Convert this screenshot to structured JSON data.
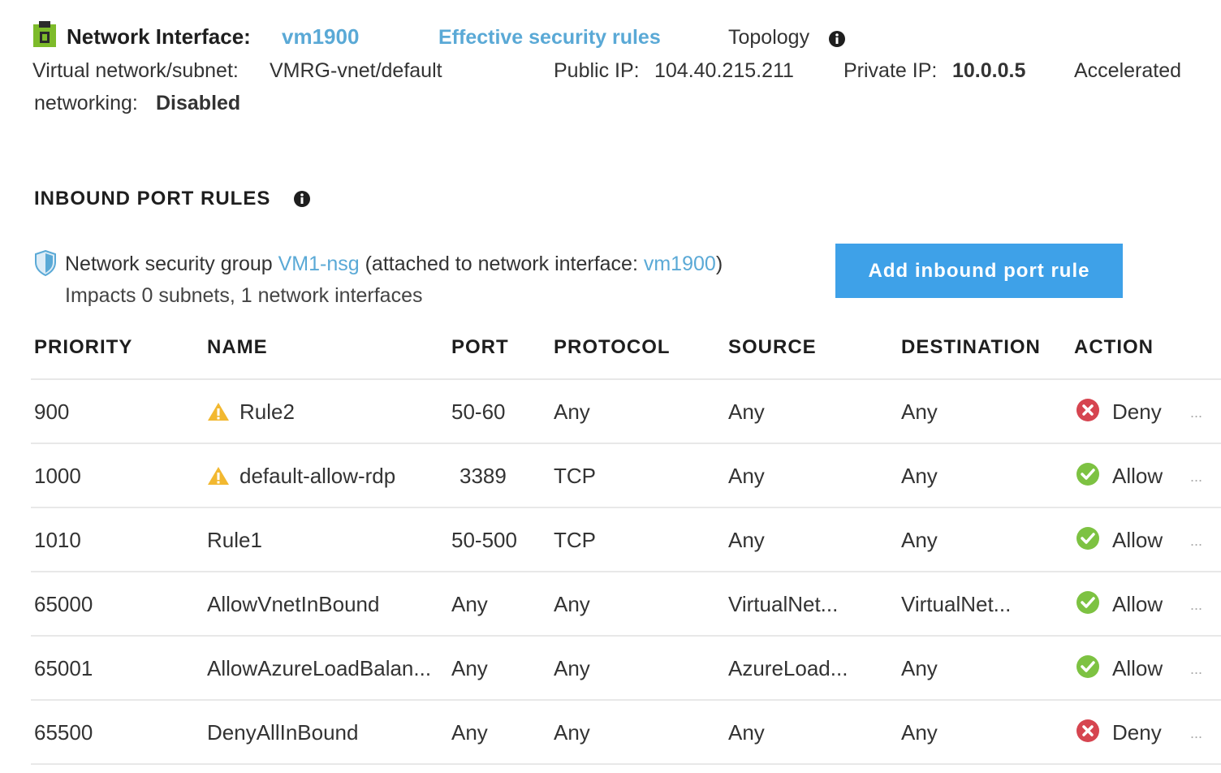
{
  "header": {
    "title": "Network Interface:",
    "vm_name": "vm1900",
    "effective_rules": "Effective security rules",
    "topology": "Topology",
    "vnet_label": "Virtual network/subnet:",
    "vnet_value": "VMRG-vnet/default",
    "public_ip_label": "Public IP:",
    "public_ip_value": "104.40.215.211",
    "private_ip_label": "Private IP:",
    "private_ip_value": "10.0.0.5",
    "accel_label_1": "Accelerated",
    "accel_label_2": "networking:",
    "accel_value": "Disabled"
  },
  "inbound": {
    "title": "INBOUND PORT RULES",
    "nsg_prefix": "Network security group",
    "nsg_name": "VM1-nsg",
    "nsg_attached": "(attached to network interface:",
    "nsg_nic": "vm1900",
    "nsg_close": ")",
    "impacts": "Impacts 0 subnets, 1 network interfaces",
    "add_button": "Add inbound port rule"
  },
  "table": {
    "columns": [
      "PRIORITY",
      "NAME",
      "PORT",
      "PROTOCOL",
      "SOURCE",
      "DESTINATION",
      "ACTION"
    ],
    "rows": [
      {
        "priority": "900",
        "name": "Rule2",
        "warning": true,
        "port": "50-60",
        "protocol": "Any",
        "source": "Any",
        "destination": "Any",
        "action": "Deny",
        "action_type": "deny"
      },
      {
        "priority": "1000",
        "name": "default-allow-rdp",
        "warning": true,
        "port": "3389",
        "protocol": "TCP",
        "source": "Any",
        "destination": "Any",
        "action": "Allow",
        "action_type": "allow"
      },
      {
        "priority": "1010",
        "name": "Rule1",
        "warning": false,
        "port": "50-500",
        "protocol": "TCP",
        "source": "Any",
        "destination": "Any",
        "action": "Allow",
        "action_type": "allow"
      },
      {
        "priority": "65000",
        "name": "AllowVnetInBound",
        "warning": false,
        "port": "Any",
        "protocol": "Any",
        "source": "VirtualNet...",
        "destination": "VirtualNet...",
        "action": "Allow",
        "action_type": "allow"
      },
      {
        "priority": "65001",
        "name": "AllowAzureLoadBalan...",
        "warning": false,
        "port": "Any",
        "protocol": "Any",
        "source": "AzureLoad...",
        "destination": "Any",
        "action": "Allow",
        "action_type": "allow"
      },
      {
        "priority": "65500",
        "name": "DenyAllInBound",
        "warning": false,
        "port": "Any",
        "protocol": "Any",
        "source": "Any",
        "destination": "Any",
        "action": "Deny",
        "action_type": "deny"
      }
    ],
    "more_label": "..."
  },
  "colors": {
    "link": "#5aa9d6",
    "button": "#3ea1e8",
    "allow": "#7dc242",
    "deny": "#d64550",
    "warning": "#f2b830"
  },
  "icons": {
    "header": "network-interface-icon",
    "info": "info-icon",
    "shield": "shield-icon",
    "warning": "warning-icon",
    "allow": "check-circle-icon",
    "deny": "x-circle-icon",
    "more": "ellipsis-icon"
  }
}
